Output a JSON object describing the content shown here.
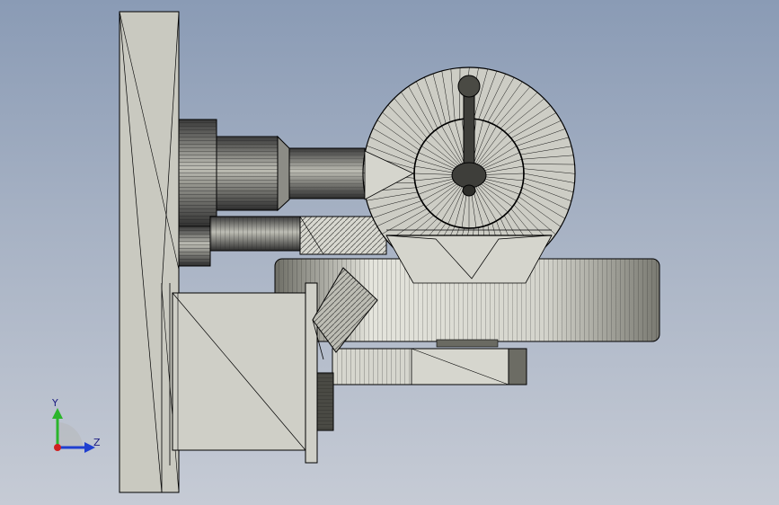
{
  "view": {
    "background_top": "#8a9bb5",
    "background_bottom": "#c6cbd5",
    "part_fill": "#c9c9c0",
    "edge_color": "#000000"
  },
  "triad": {
    "y_label": "Y",
    "z_label": "Z",
    "y_color": "#2bb52b",
    "z_color": "#1f3fd0",
    "x_color": "#d02020"
  }
}
